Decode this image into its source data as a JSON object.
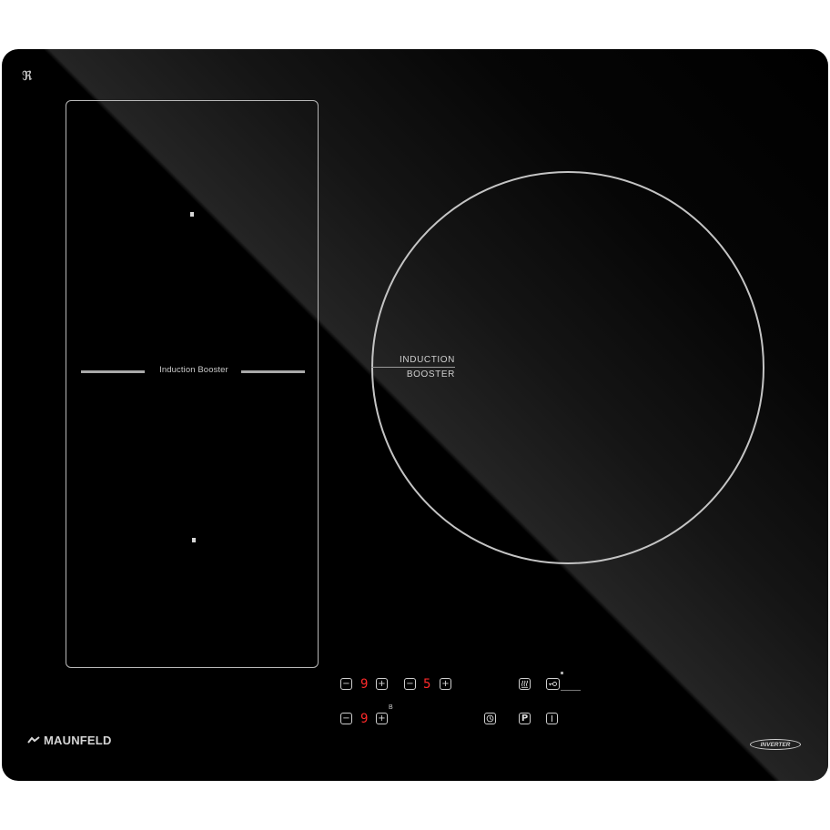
{
  "hob": {
    "brand": "MAUNFELD",
    "badge": "INVERTER",
    "flex_zone": {
      "divider_label": "Induction Booster"
    },
    "round_zone": {
      "label_line1": "INDUCTION",
      "label_line2": "BOOSTER"
    },
    "controls": {
      "zone_front_left": {
        "minus": "−",
        "level": "9",
        "plus": "+"
      },
      "zone_right": {
        "minus": "−",
        "level": "5",
        "plus": "+"
      },
      "zone_rear_left": {
        "minus": "−",
        "level": "9",
        "plus": "+",
        "booster_mark": "B"
      }
    },
    "icons": {
      "top_left": "child-lock-symbol-icon",
      "logo": "maunfeld-logo-icon",
      "keep_warm": "keep-warm-icon",
      "lock": "lock-icon",
      "timer": "timer-icon",
      "pause": "pause-icon",
      "power": "power-icon"
    },
    "colors": {
      "glass": "#000000",
      "display": "#ff2a2a",
      "outline": "#c4c4c4"
    }
  }
}
